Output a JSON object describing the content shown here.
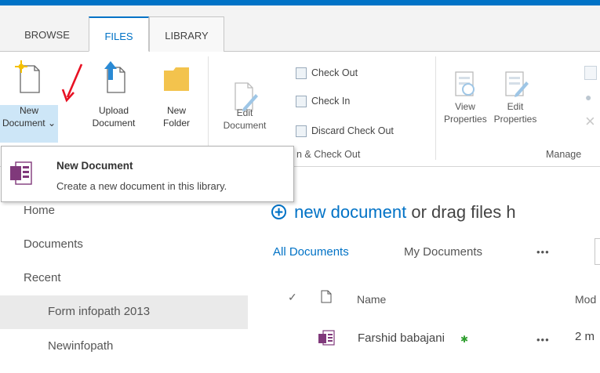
{
  "tabs": [
    {
      "label": "BROWSE"
    },
    {
      "label": "FILES"
    },
    {
      "label": "LIBRARY"
    }
  ],
  "ribbon": {
    "new_document": {
      "line1": "New",
      "line2": "Document ⌄"
    },
    "upload_document": {
      "line1": "Upload",
      "line2": "Document"
    },
    "new_folder": {
      "line1": "New",
      "line2": "Folder"
    },
    "edit_document": {
      "line1": "Edit",
      "line2": "Document"
    },
    "check_out": "Check Out",
    "check_in": "Check In",
    "discard_check_out": "Discard Check Out",
    "group_open_checkout": "n & Check Out",
    "view_properties": {
      "line1": "View",
      "line2": "Properties"
    },
    "edit_properties": {
      "line1": "Edit",
      "line2": "Properties"
    },
    "group_manage": "Manage"
  },
  "tooltip": {
    "title": "New Document",
    "description": "Create a new document in this library."
  },
  "leftnav": {
    "home": "Home",
    "documents": "Documents",
    "recent": "Recent",
    "recent_items": [
      "Form infopath 2013",
      "Newinfopath"
    ]
  },
  "main": {
    "new_document_link": "new document",
    "drag_text": "or drag files h",
    "views": {
      "all": "All Documents",
      "mine": "My Documents",
      "more": "•••"
    },
    "columns": {
      "name": "Name",
      "modified": "Mod"
    },
    "rows": [
      {
        "name": "Farshid babajani",
        "new_marker": "✱",
        "menu": "•••",
        "modified": "2 m"
      }
    ]
  },
  "colors": {
    "accent": "#0072c6",
    "arrow": "#e81123",
    "folder": "#f3c34d",
    "onenote": "#80397b"
  }
}
